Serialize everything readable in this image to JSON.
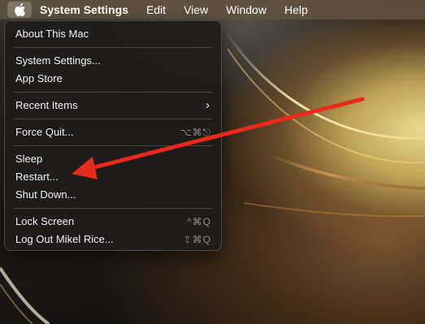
{
  "menubar": {
    "apple_icon": "apple-logo-icon",
    "items": [
      "System Settings",
      "Edit",
      "View",
      "Window",
      "Help"
    ]
  },
  "apple_menu": {
    "about": "About This Mac",
    "system_settings": "System Settings...",
    "app_store": "App Store",
    "recent_items": "Recent Items",
    "recent_items_chevron": "›",
    "force_quit": "Force Quit...",
    "force_quit_shortcut": "⌥⌘⎋",
    "sleep": "Sleep",
    "restart": "Restart...",
    "shut_down": "Shut Down...",
    "lock_screen": "Lock Screen",
    "lock_screen_shortcut": "^⌘Q",
    "log_out": "Log Out Mikel Rice...",
    "log_out_shortcut": "⇧⌘Q"
  },
  "annotation": {
    "arrow_color": "#e8291c",
    "points_to": "Restart..."
  },
  "colors": {
    "menubar_bg": "#5f5242",
    "menu_bg": "#1e1c1b",
    "menu_text": "#f2f2f2",
    "shortcut_text": "#8d8a87",
    "wallpaper_glow": "#f6e496"
  }
}
